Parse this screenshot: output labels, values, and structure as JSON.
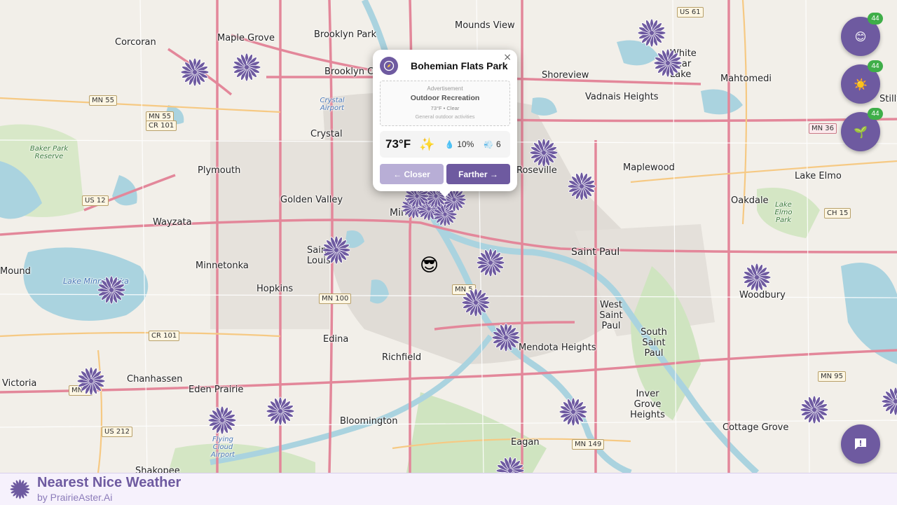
{
  "app": {
    "title": "Nearest Nice Weather",
    "subtitle": "by PrairieAster.Ai",
    "accent_color": "#6e5aa0",
    "accent_light": "#b8aed6",
    "badge_color": "#3fae49"
  },
  "popup": {
    "icon": "compass-icon",
    "title": "Bohemian Flats Park",
    "close": "×",
    "ad": {
      "tag": "Advertisement",
      "title": "Outdoor Recreation",
      "sub": "73°F • Clear",
      "desc": "General outdoor activities"
    },
    "weather": {
      "temp": "73°F",
      "condition_icon": "✨",
      "precip_icon": "💧",
      "precip": "10%",
      "wind_icon": "💨",
      "wind": "6"
    },
    "closer_label": "← Closer",
    "farther_label": "Farther →"
  },
  "filters": [
    {
      "name": "mood",
      "icon": "😊",
      "count": "44"
    },
    {
      "name": "weather",
      "icon": "☀️",
      "count": "44"
    },
    {
      "name": "activity",
      "icon": "🌱",
      "count": "44"
    }
  ],
  "feedback": {
    "icon": "feedback-icon"
  },
  "user_marker": {
    "icon": "😎"
  },
  "map": {
    "cities": [
      {
        "text": "Maple Grove"
      },
      {
        "text": "Brooklyn Park"
      },
      {
        "text": "Corcoran"
      },
      {
        "text": "Mounds View"
      },
      {
        "text": "Shoreview"
      },
      {
        "text": "Vadnais Heights"
      },
      {
        "text": "White Bear Lake"
      },
      {
        "text": "Mahtomedi"
      },
      {
        "text": "Brooklyn Center"
      },
      {
        "text": "Crystal"
      },
      {
        "text": "Plymouth"
      },
      {
        "text": "Roseville"
      },
      {
        "text": "Maplewood"
      },
      {
        "text": "Lake Elmo"
      },
      {
        "text": "Oakdale"
      },
      {
        "text": "Golden Valley"
      },
      {
        "text": "Wayzata"
      },
      {
        "text": "Minneapolis"
      },
      {
        "text": "Saint Paul"
      },
      {
        "text": "Minnetonka"
      },
      {
        "text": "Saint Louis Park"
      },
      {
        "text": "Hopkins"
      },
      {
        "text": "Mound"
      },
      {
        "text": "Woodbury"
      },
      {
        "text": "West Saint Paul"
      },
      {
        "text": "South Saint Paul"
      },
      {
        "text": "Edina"
      },
      {
        "text": "Mendota Heights"
      },
      {
        "text": "Richfield"
      },
      {
        "text": "Chanhassen"
      },
      {
        "text": "Eden Prairie"
      },
      {
        "text": "Victoria"
      },
      {
        "text": "Inver Grove Heights"
      },
      {
        "text": "Bloomington"
      },
      {
        "text": "Eagan"
      },
      {
        "text": "Cottage Grove"
      },
      {
        "text": "Shakopee"
      },
      {
        "text": "Stillwater"
      }
    ],
    "water_labels": [
      {
        "text": "Lake Minnetonka"
      },
      {
        "text": "Crystal Airport"
      },
      {
        "text": "Flying Cloud Airport"
      }
    ],
    "park_labels": [
      {
        "text": "Baker Park Reserve"
      },
      {
        "text": "Lake Elmo Park"
      }
    ],
    "shields": [
      {
        "text": "US 61"
      },
      {
        "text": "MN 55"
      },
      {
        "text": "MN 55"
      },
      {
        "text": "CR 101"
      },
      {
        "text": "US 12"
      },
      {
        "text": "MN 36"
      },
      {
        "text": "CH 15"
      },
      {
        "text": "MN 100"
      },
      {
        "text": "MN 5"
      },
      {
        "text": "CR 101"
      },
      {
        "text": "MN 5"
      },
      {
        "text": "US 212"
      },
      {
        "text": "MN 95"
      },
      {
        "text": "MN 149"
      }
    ],
    "markers_count": 26
  }
}
